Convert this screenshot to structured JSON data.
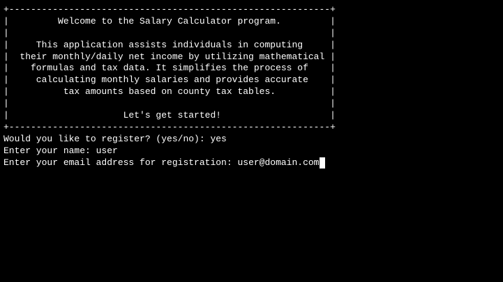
{
  "banner": {
    "border_top": "+-----------------------------------------------------------+",
    "lines": [
      "|         Welcome to the Salary Calculator program.         |",
      "|                                                           |",
      "|     This application assists individuals in computing     |",
      "|  their monthly/daily net income by utilizing mathematical |",
      "|    formulas and tax data. It simplifies the process of    |",
      "|     calculating monthly salaries and provides accurate    |",
      "|          tax amounts based on county tax tables.          |",
      "|                                                           |",
      "|                     Let's get started!                    |"
    ],
    "border_bottom": "+-----------------------------------------------------------+"
  },
  "session": {
    "register_prompt": "Would you like to register? (yes/no): ",
    "register_answer": "yes",
    "name_prompt": "Enter your name: ",
    "name_answer": "user",
    "email_prompt": "Enter your email address for registration: ",
    "email_input": "user@domain.com"
  },
  "colors": {
    "background": "#000000",
    "foreground": "#ffffff"
  }
}
